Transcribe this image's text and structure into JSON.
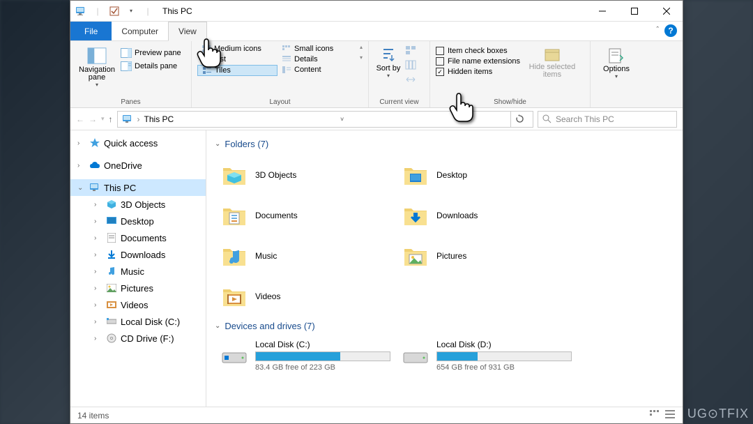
{
  "window": {
    "title": "This PC"
  },
  "menu": {
    "file": "File",
    "computer": "Computer",
    "view": "View"
  },
  "ribbon": {
    "panes": {
      "label": "Panes",
      "navigation_pane": "Navigation pane",
      "preview_pane": "Preview pane",
      "details_pane": "Details pane"
    },
    "layout": {
      "label": "Layout",
      "medium_icons": "Medium icons",
      "small_icons": "Small icons",
      "list": "List",
      "details": "Details",
      "tiles": "Tiles",
      "content": "Content"
    },
    "current_view": {
      "label": "Current view",
      "sort_by": "Sort by"
    },
    "show_hide": {
      "label": "Show/hide",
      "item_check_boxes": "Item check boxes",
      "file_name_ext": "File name extensions",
      "hidden_items": "Hidden items",
      "hide_selected": "Hide selected items"
    },
    "options": "Options"
  },
  "address": {
    "location": "This PC",
    "search_placeholder": "Search This PC"
  },
  "sidebar": {
    "quick_access": "Quick access",
    "onedrive": "OneDrive",
    "this_pc": "This PC",
    "items": [
      "3D Objects",
      "Desktop",
      "Documents",
      "Downloads",
      "Music",
      "Pictures",
      "Videos",
      "Local Disk (C:)",
      "CD Drive (F:)"
    ]
  },
  "content": {
    "folders_header": "Folders (7)",
    "folders": [
      "3D Objects",
      "Desktop",
      "Documents",
      "Downloads",
      "Music",
      "Pictures",
      "Videos"
    ],
    "drives_header": "Devices and drives (7)",
    "drives": [
      {
        "name": "Local Disk (C:)",
        "free": "83.4 GB free of 223 GB",
        "used_pct": 63
      },
      {
        "name": "Local Disk (D:)",
        "free": "654 GB free of 931 GB",
        "used_pct": 30
      }
    ]
  },
  "status": {
    "items": "14 items"
  },
  "watermark": "UG⊙TFIX"
}
